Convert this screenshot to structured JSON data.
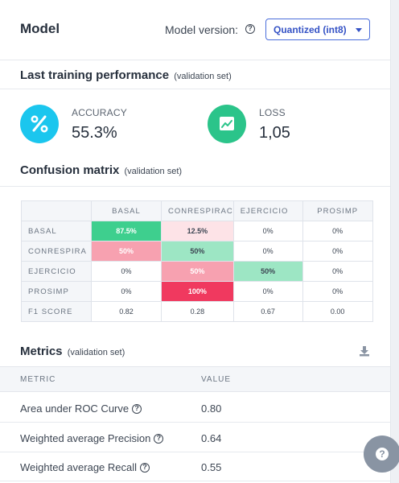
{
  "panel": {
    "title": "Model",
    "version_label": "Model version:",
    "version_selected": "Quantized (int8)"
  },
  "performance": {
    "title": "Last training performance",
    "subtitle": "(validation set)",
    "accuracy": {
      "label": "ACCURACY",
      "value": "55.3%",
      "icon": "percent-icon",
      "color": "#1bc6ee"
    },
    "loss": {
      "label": "LOSS",
      "value": "1,05",
      "icon": "trend-chart-icon",
      "color": "#2bc48a"
    }
  },
  "confusion": {
    "title": "Confusion matrix",
    "subtitle": "(validation set)",
    "columns": [
      "BASAL",
      "CONRESPIRAC",
      "EJERCICIO",
      "PROSIMP"
    ],
    "rows": [
      {
        "label": "BASAL",
        "cells": [
          "87.5%",
          "12.5%",
          "0%",
          "0%"
        ],
        "colors": [
          "#3ecf8e",
          "#fde3e7",
          "#ffffff",
          "#ffffff"
        ],
        "text": [
          "#ffffff",
          "#3d4653",
          "#3d4653",
          "#3d4653"
        ]
      },
      {
        "label": "CONRESPIRA",
        "cells": [
          "50%",
          "50%",
          "0%",
          "0%"
        ],
        "colors": [
          "#f7a1b0",
          "#9de6c4",
          "#ffffff",
          "#ffffff"
        ],
        "text": [
          "#ffffff",
          "#3d4653",
          "#3d4653",
          "#3d4653"
        ]
      },
      {
        "label": "EJERCICIO",
        "cells": [
          "0%",
          "50%",
          "50%",
          "0%"
        ],
        "colors": [
          "#ffffff",
          "#f7a1b0",
          "#9de6c4",
          "#ffffff"
        ],
        "text": [
          "#3d4653",
          "#ffffff",
          "#3d4653",
          "#3d4653"
        ]
      },
      {
        "label": "PROSIMP",
        "cells": [
          "0%",
          "100%",
          "0%",
          "0%"
        ],
        "colors": [
          "#ffffff",
          "#f0395f",
          "#ffffff",
          "#ffffff"
        ],
        "text": [
          "#3d4653",
          "#ffffff",
          "#3d4653",
          "#3d4653"
        ]
      }
    ],
    "f1": {
      "label": "F1 SCORE",
      "values": [
        "0.82",
        "0.28",
        "0.67",
        "0.00"
      ]
    }
  },
  "metrics": {
    "title": "Metrics",
    "subtitle": "(validation set)",
    "col_metric": "METRIC",
    "col_value": "VALUE",
    "rows": [
      {
        "name": "Area under ROC Curve",
        "value": "0.80"
      },
      {
        "name": "Weighted average Precision",
        "value": "0.64"
      },
      {
        "name": "Weighted average Recall",
        "value": "0.55"
      }
    ]
  },
  "help_fab": {
    "glyph": "?"
  }
}
